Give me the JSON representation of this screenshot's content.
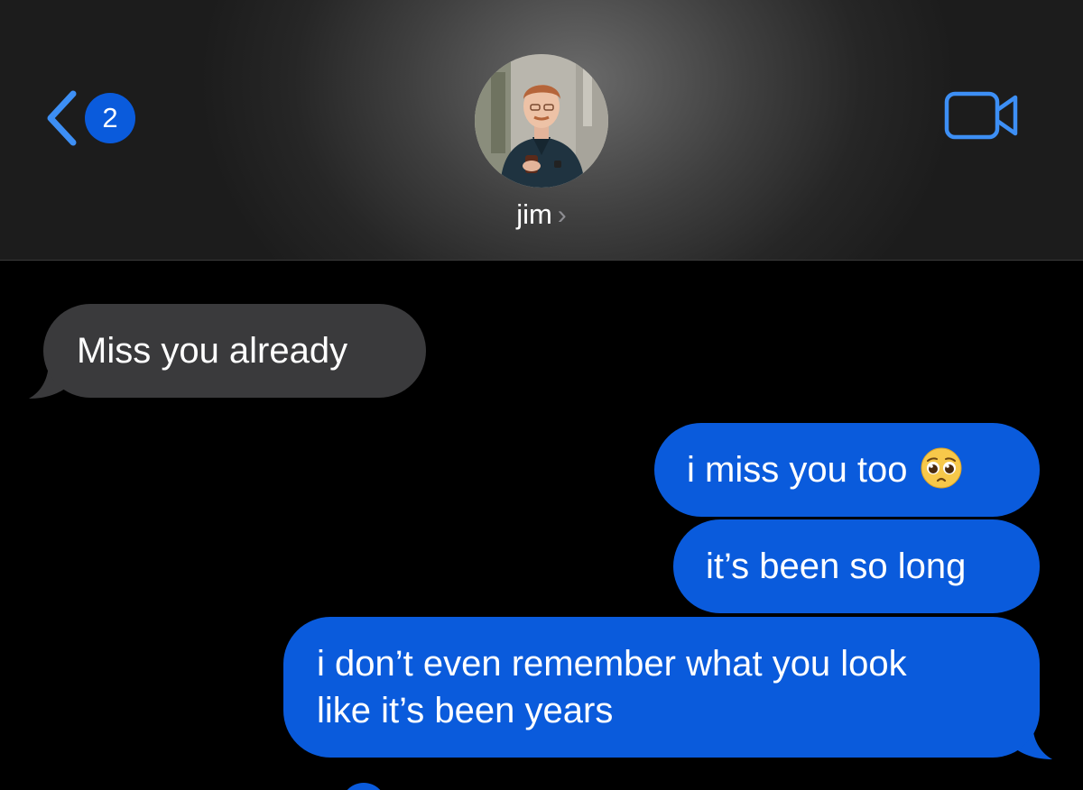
{
  "header": {
    "back_badge_count": "2",
    "contact_name": "jim",
    "contact_chevron": "›",
    "back_icon": "chevron-left-icon",
    "video_icon": "video-camera-icon"
  },
  "messages": [
    {
      "direction": "incoming",
      "text": "Miss you already"
    },
    {
      "direction": "outgoing",
      "text": "i miss you too",
      "emoji": "pleading-face-emoji"
    },
    {
      "direction": "outgoing",
      "text": "it’s been so long"
    },
    {
      "direction": "outgoing",
      "line1": "i don’t even remember what you look",
      "line2": "like it’s been years"
    }
  ],
  "colors": {
    "accent": "#0a5bdc",
    "incoming_bubble": "#3a3a3c",
    "icon_blue": "#3d8ff5"
  }
}
